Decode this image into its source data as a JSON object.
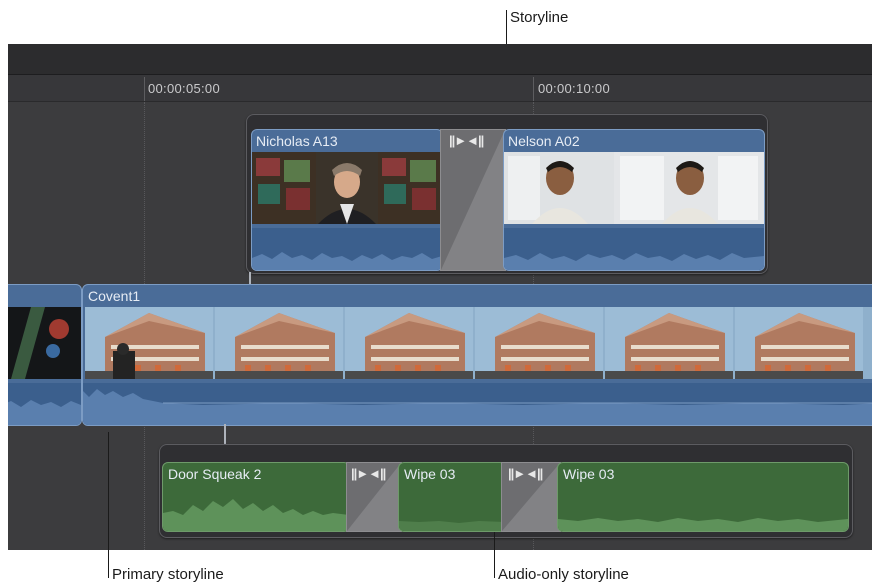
{
  "callouts": {
    "storyline": "Storyline",
    "primary": "Primary storyline",
    "audio_only": "Audio-only storyline"
  },
  "ruler": {
    "timecodes": [
      "00:00:05:00",
      "00:00:10:00"
    ]
  },
  "storyline": {
    "clip1_name": "Nicholas A13",
    "clip2_name": "Nelson A02",
    "transition_icon": "||►◄||"
  },
  "primary": {
    "clip_name": "Covent1"
  },
  "audio_storyline": {
    "clip1_name": "Door Squeak 2",
    "clip2_name": "Wipe 03",
    "clip3_name": "Wipe 03",
    "transition_icon": "||►◄||"
  },
  "colors": {
    "video_clip": "#4a6c98",
    "audio_clip": "#3d6a3a",
    "transition": "#6d6d70",
    "timeline_bg": "#3c3c3e"
  }
}
